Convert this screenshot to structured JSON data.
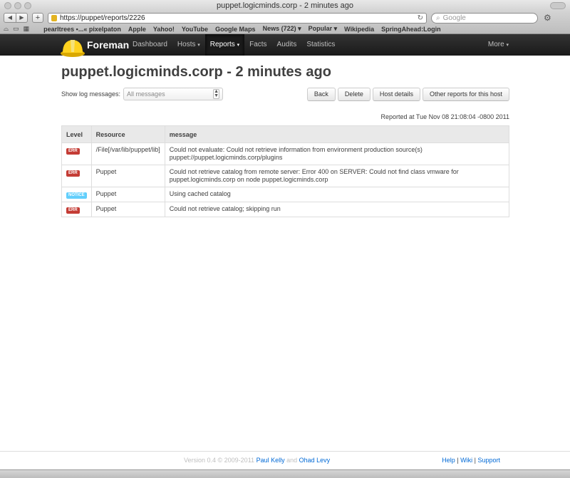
{
  "window": {
    "title": "puppet.logicminds.corp - 2 minutes ago"
  },
  "browser": {
    "url": "https://puppet/reports/2226",
    "search_placeholder": "Google",
    "bookmarks": [
      "pearltrees •...« pixelpaton",
      "Apple",
      "Yahoo!",
      "YouTube",
      "Google Maps",
      "News (722) ▾",
      "Popular ▾",
      "Wikipedia",
      "SpringAhead:Login"
    ]
  },
  "navbar": {
    "brand": "Foreman",
    "items": [
      {
        "label": "Dashboard"
      },
      {
        "label": "Hosts",
        "caret": "▾"
      },
      {
        "label": "Reports",
        "caret": "▾"
      },
      {
        "label": "Facts"
      },
      {
        "label": "Audits"
      },
      {
        "label": "Statistics"
      }
    ],
    "more_label": "More",
    "more_caret": "▾"
  },
  "page": {
    "title": "puppet.logicminds.corp - 2 minutes ago",
    "filter_label": "Show log messages:",
    "filter_value": "All messages",
    "buttons": {
      "back": "Back",
      "delete": "Delete",
      "host_details": "Host details",
      "other_reports": "Other reports for this host"
    },
    "reported_at": "Reported at Tue Nov 08 21:08:04 -0800 2011"
  },
  "table": {
    "headers": {
      "level": "Level",
      "resource": "Resource",
      "message": "message"
    },
    "rows": [
      {
        "level": "ERR",
        "resource": "/File[/var/lib/puppet/lib]",
        "message": "Could not evaluate: Could not retrieve information from environment production source(s) puppet://puppet.logicminds.corp/plugins"
      },
      {
        "level": "ERR",
        "resource": "Puppet",
        "message": "Could not retrieve catalog from remote server: Error 400 on SERVER: Could not find class vmware for puppet.logicminds.corp on node puppet.logicminds.corp"
      },
      {
        "level": "NOTICE",
        "resource": "Puppet",
        "message": "Using cached catalog"
      },
      {
        "level": "ERR",
        "resource": "Puppet",
        "message": "Could not retrieve catalog; skipping run"
      }
    ]
  },
  "footer": {
    "version": "Version 0.4 © 2009-2011",
    "author1": "Paul Kelly",
    "and": "and",
    "author2": "Ohad Levy",
    "links": [
      "Help",
      "Wiki",
      "Support"
    ],
    "separator": "|"
  },
  "colors": {
    "navbar_bg": "#222222",
    "err_badge": "#c43c35",
    "notice_badge": "#62cffc",
    "link": "#0069d6"
  }
}
